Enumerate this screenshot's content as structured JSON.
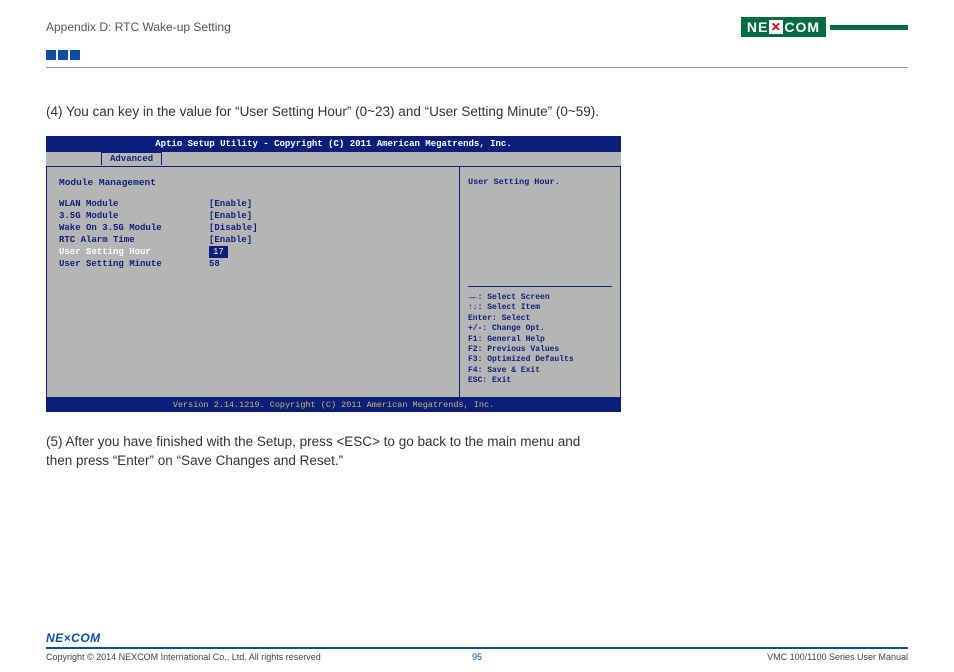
{
  "header": {
    "title": "Appendix D: RTC Wake-up Setting",
    "logo_left": "NE",
    "logo_right": "COM"
  },
  "step4": "(4) You can key in the value for “User Setting Hour” (0~23) and “User Setting Minute” (0~59).",
  "bios": {
    "top": "Aptio Setup Utility - Copyright (C) 2011 American Megatrends, Inc.",
    "tab": "Advanced",
    "section": "Module Management",
    "rows": [
      {
        "label": "WLAN Module",
        "value": "[Enable]"
      },
      {
        "label": "3.5G Module",
        "value": "[Enable]"
      },
      {
        "label": "Wake On 3.5G Module",
        "value": "[Disable]"
      },
      {
        "label": "RTC Alarm Time",
        "value": "[Enable]"
      },
      {
        "label": "User Setting Hour",
        "value": "17",
        "selected": true
      },
      {
        "label": "User Setting Minute",
        "value": "58"
      }
    ],
    "help_title": "User Setting Hour.",
    "keys": [
      "→←: Select Screen",
      "↑↓: Select Item",
      "Enter: Select",
      "+/-: Change Opt.",
      "F1: General Help",
      "F2: Previous Values",
      "F3: Optimized Defaults",
      "F4: Save & Exit",
      "ESC: Exit"
    ],
    "bottom": "Version 2.14.1219. Copyright (C) 2011 American Megatrends, Inc."
  },
  "step5": "(5) After you have finished with the Setup, press <ESC> to go back to the main menu and then press “Enter” on “Save Changes and Reset.”",
  "footer": {
    "logo": "NE×COM",
    "copyright": "Copyright © 2014 NEXCOM International Co., Ltd. All rights reserved",
    "page": "95",
    "manual": "VMC 100/1100 Series User Manual"
  }
}
